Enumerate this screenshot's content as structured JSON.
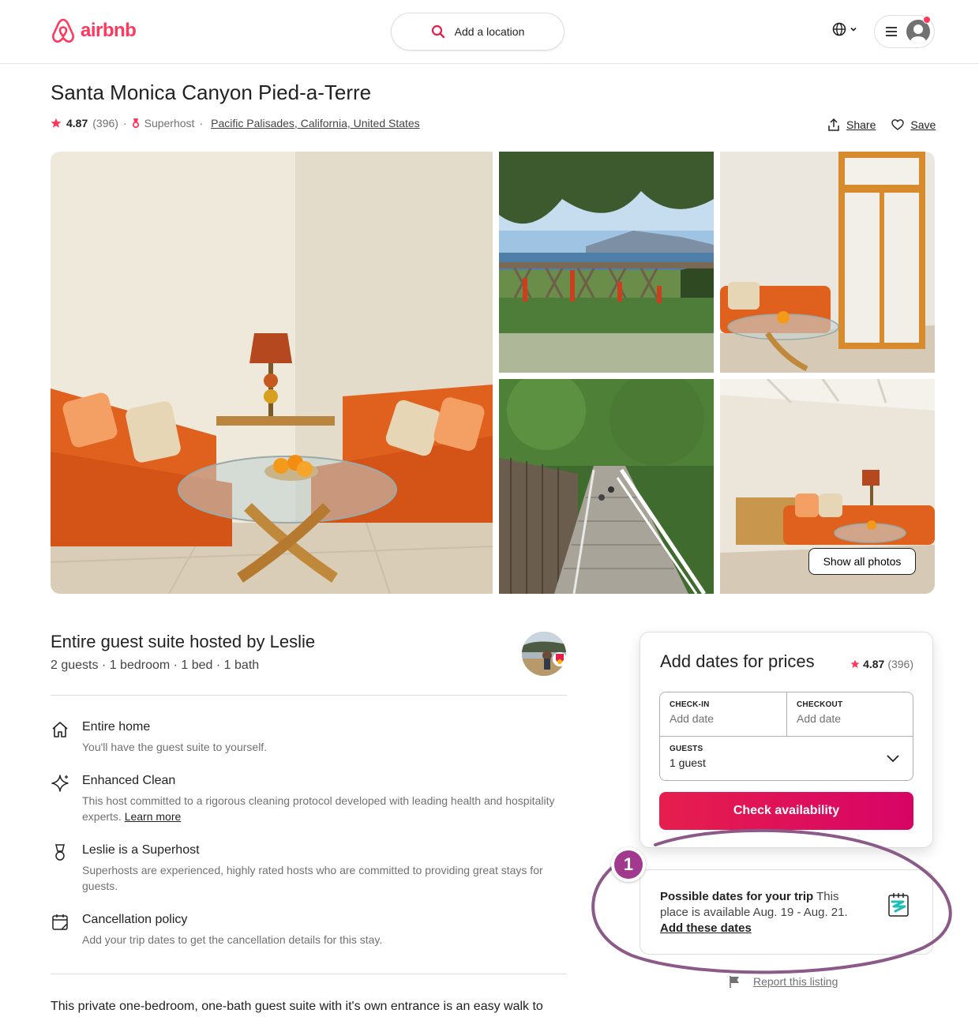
{
  "header": {
    "logo_text": "airbnb",
    "search_placeholder": "Add a location",
    "brand_color": "#ff385c"
  },
  "listing": {
    "title": "Santa Monica Canyon Pied-a-Terre",
    "rating": "4.87",
    "reviews": "(396)",
    "separator": "·",
    "superhost_label": "Superhost",
    "location": "Pacific Palisades, California, United States",
    "share_label": "Share",
    "save_label": "Save",
    "show_all_photos": "Show all photos"
  },
  "host": {
    "title": "Entire guest suite hosted by Leslie",
    "details": "2 guests · 1 bedroom · 1 bed · 1 bath"
  },
  "features": [
    {
      "icon": "home-icon",
      "title": "Entire home",
      "desc": "You'll have the guest suite to yourself."
    },
    {
      "icon": "sparkle-icon",
      "title": "Enhanced Clean",
      "desc": "This host committed to a rigorous cleaning protocol developed with leading health and hospitality experts.",
      "link": "Learn more"
    },
    {
      "icon": "superhost-medal-icon",
      "title": "Leslie is a Superhost",
      "desc": "Superhosts are experienced, highly rated hosts who are committed to providing great stays for guests."
    },
    {
      "icon": "calendar-icon",
      "title": "Cancellation policy",
      "desc": "Add your trip dates to get the cancellation details for this stay."
    }
  ],
  "description": "This private one-bedroom, one-bath guest suite with it's own entrance is an easy walk to",
  "booking": {
    "title": "Add dates for prices",
    "rating": "4.87",
    "reviews": "(396)",
    "checkin_label": "CHECK-IN",
    "checkin_value": "Add date",
    "checkout_label": "CHECKOUT",
    "checkout_value": "Add date",
    "guests_label": "GUESTS",
    "guests_value": "1 guest",
    "button": "Check availability"
  },
  "possible_dates": {
    "heading": "Possible dates for your trip",
    "body": "This place is available Aug. 19 - Aug. 21.",
    "link": "Add these dates"
  },
  "report_label": "Report this listing",
  "annotation": {
    "number": "1",
    "color": "#a1398f"
  }
}
